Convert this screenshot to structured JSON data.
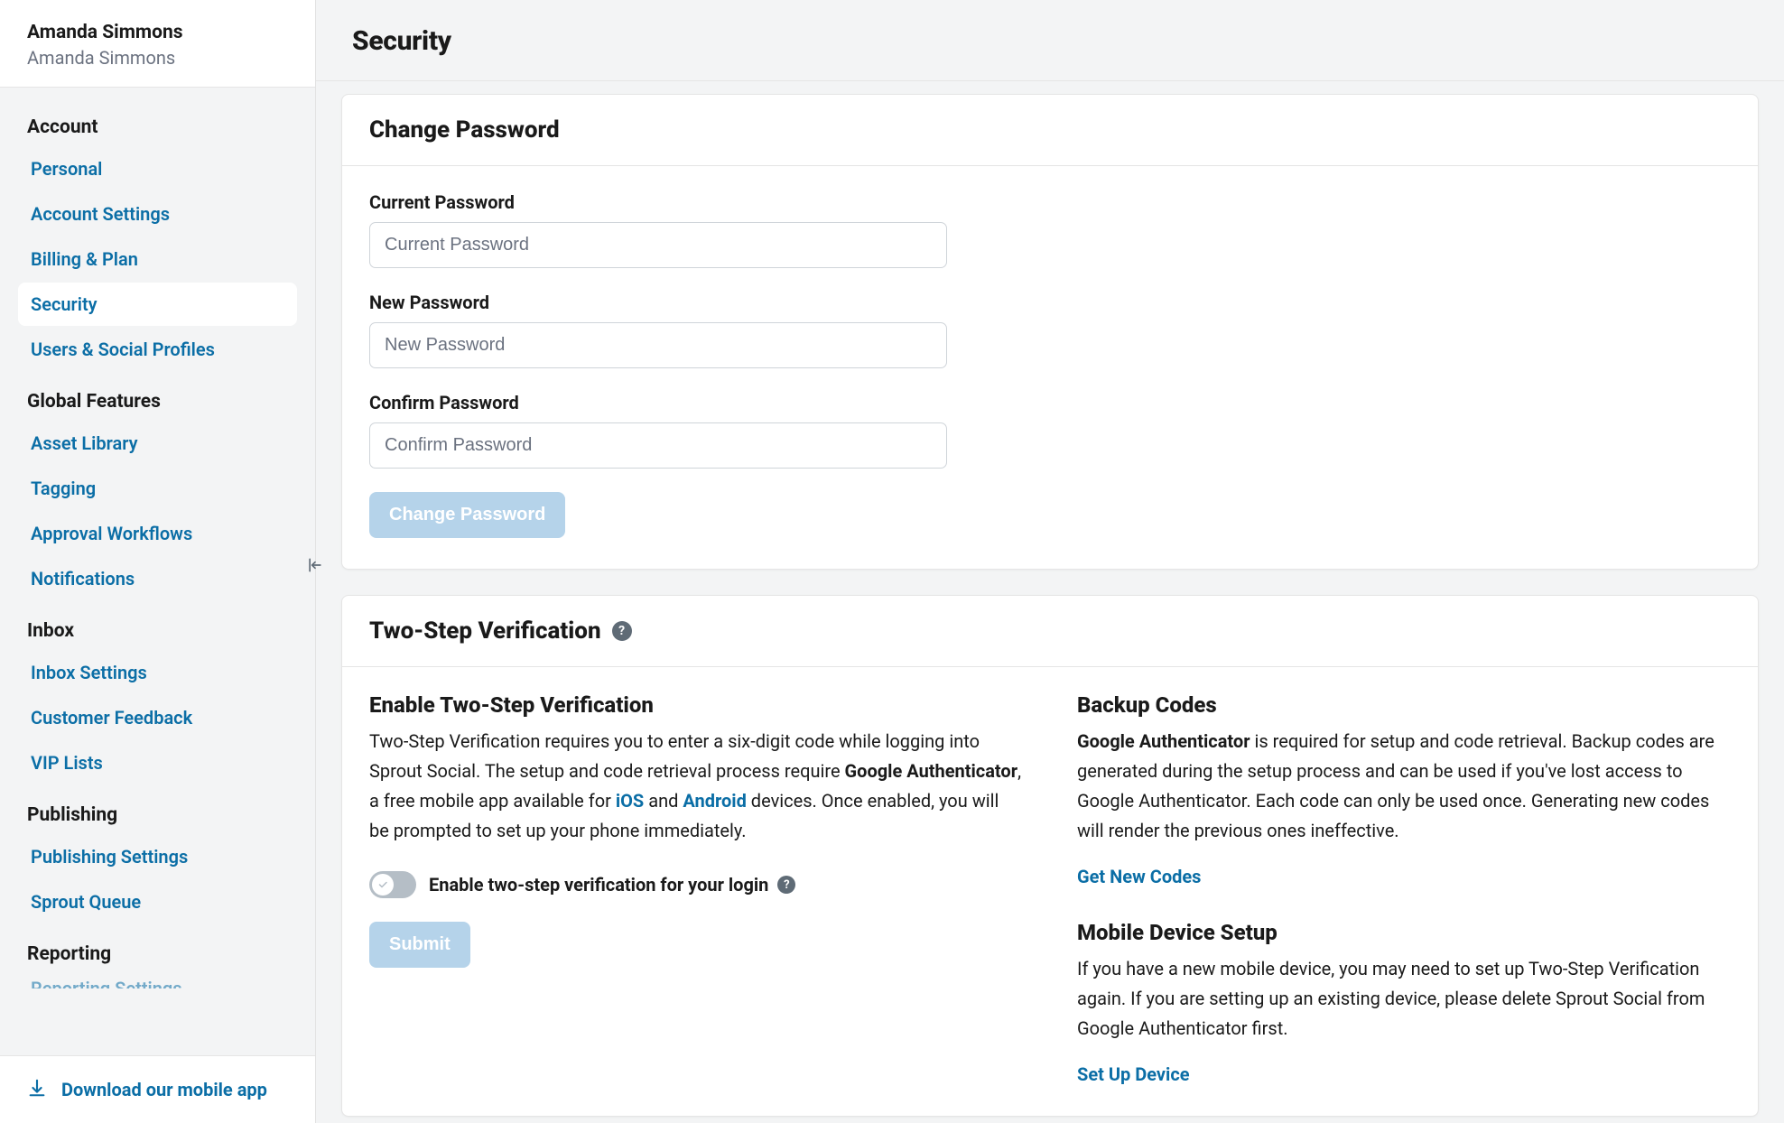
{
  "user": {
    "name": "Amanda Simmons",
    "subtitle": "Amanda Simmons"
  },
  "sidebar": {
    "sections": [
      {
        "title": "Account",
        "items": [
          "Personal",
          "Account Settings",
          "Billing & Plan",
          "Security",
          "Users & Social Profiles"
        ],
        "activeIndex": 3
      },
      {
        "title": "Global Features",
        "items": [
          "Asset Library",
          "Tagging",
          "Approval Workflows",
          "Notifications"
        ]
      },
      {
        "title": "Inbox",
        "items": [
          "Inbox Settings",
          "Customer Feedback",
          "VIP Lists"
        ]
      },
      {
        "title": "Publishing",
        "items": [
          "Publishing Settings",
          "Sprout Queue"
        ]
      },
      {
        "title": "Reporting",
        "items": [
          "Reporting Settings"
        ]
      }
    ],
    "download": "Download our mobile app"
  },
  "page": {
    "title": "Security"
  },
  "password": {
    "card_title": "Change Password",
    "current_label": "Current Password",
    "current_placeholder": "Current Password",
    "new_label": "New Password",
    "new_placeholder": "New Password",
    "confirm_label": "Confirm Password",
    "confirm_placeholder": "Confirm Password",
    "button": "Change Password"
  },
  "twostep": {
    "card_title": "Two-Step Verification",
    "left": {
      "heading": "Enable Two-Step Verification",
      "p1_a": "Two-Step Verification requires you to enter a six-digit code while logging into Sprout Social. The setup and code retrieval process require ",
      "ga": "Google Authenticator",
      "p1_b": ", a free mobile app available for ",
      "ios": "iOS",
      "and": " and ",
      "android": "Android",
      "p1_c": " devices. Once enabled, you will be prompted to set up your phone immediately.",
      "toggle_label": "Enable two-step verification for your login",
      "submit": "Submit"
    },
    "right": {
      "backup_heading": "Backup Codes",
      "backup_ga": "Google Authenticator",
      "backup_text": " is required for setup and code retrieval. Backup codes are generated during the setup process and can be used if you've lost access to Google Authenticator. Each code can only be used once. Generating new codes will render the previous ones ineffective.",
      "get_codes": "Get New Codes",
      "mobile_heading": "Mobile Device Setup",
      "mobile_text": "If you have a new mobile device, you may need to set up Two-Step Verification again. If you are setting up an existing device, please delete Sprout Social from Google Authenticator first.",
      "setup_device": "Set Up Device"
    }
  }
}
